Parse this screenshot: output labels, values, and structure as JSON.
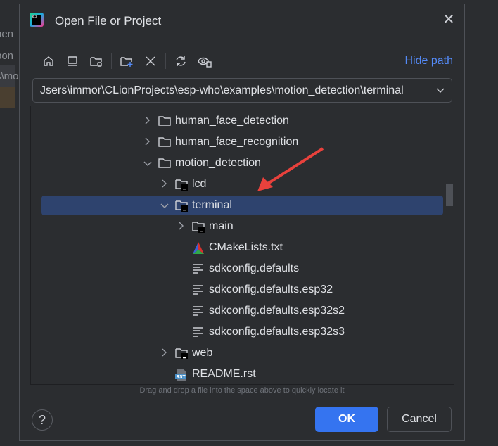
{
  "background": {
    "fragments": [
      "nen",
      "pon",
      "s\\mo"
    ]
  },
  "dialog": {
    "title": "Open File or Project",
    "hide_path": "Hide path",
    "path": "Jsers\\immor\\CLionProjects\\esp-who\\examples\\motion_detection\\terminal",
    "hint": "Drag and drop a file into the space above to quickly locate it",
    "ok": "OK",
    "cancel": "Cancel",
    "help": "?"
  },
  "toolbar": [
    "home-icon",
    "desktop-icon",
    "project-folder-icon",
    "new-folder-icon",
    "delete-icon",
    "refresh-icon",
    "show-hidden-icon"
  ],
  "tree": [
    {
      "label": "human_face_detection",
      "level": 0,
      "type": "folder",
      "expanded": false
    },
    {
      "label": "human_face_recognition",
      "level": 0,
      "type": "folder",
      "expanded": false
    },
    {
      "label": "motion_detection",
      "level": 0,
      "type": "folder",
      "expanded": true
    },
    {
      "label": "lcd",
      "level": 1,
      "type": "module",
      "expanded": false
    },
    {
      "label": "terminal",
      "level": 1,
      "type": "module",
      "expanded": true,
      "selected": true
    },
    {
      "label": "main",
      "level": 2,
      "type": "module",
      "expanded": false
    },
    {
      "label": "CMakeLists.txt",
      "level": 2,
      "type": "cmake"
    },
    {
      "label": "sdkconfig.defaults",
      "level": 2,
      "type": "text"
    },
    {
      "label": "sdkconfig.defaults.esp32",
      "level": 2,
      "type": "text"
    },
    {
      "label": "sdkconfig.defaults.esp32s2",
      "level": 2,
      "type": "text"
    },
    {
      "label": "sdkconfig.defaults.esp32s3",
      "level": 2,
      "type": "text"
    },
    {
      "label": "web",
      "level": 1,
      "type": "module",
      "expanded": false
    },
    {
      "label": "README.rst",
      "level": 1,
      "type": "rst"
    }
  ],
  "colors": {
    "accent": "#3574f0",
    "link": "#548af7",
    "selection": "#2e436e",
    "annotation_arrow": "#e8413c"
  }
}
